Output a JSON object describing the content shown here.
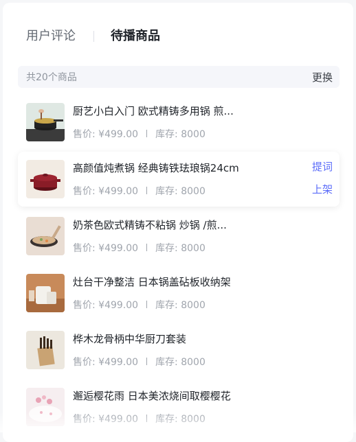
{
  "tabs": [
    {
      "label": "用户评论",
      "active": false
    },
    {
      "label": "待播商品",
      "active": true
    }
  ],
  "summary": {
    "count_text": "共20个商品",
    "refresh_label": "更换"
  },
  "products": [
    {
      "title": "厨艺小白入门 欧式精铸多用锅 煎...",
      "price": "售价: ¥499.00",
      "stock": "库存: 8000",
      "image": "pot-cooking-icon"
    },
    {
      "title": "高颜值炖煮锅 经典铸铁珐琅锅24cm",
      "price": "售价: ¥499.00",
      "stock": "库存: 8000",
      "image": "red-enamel-pot-icon",
      "actions": [
        "提词",
        "上架"
      ]
    },
    {
      "title": "奶茶色欧式精铸不粘锅 炒锅 /煎...",
      "price": "售价: ¥499.00",
      "stock": "库存: 8000",
      "image": "wok-icon"
    },
    {
      "title": "灶台干净整洁 日本锅盖砧板收纳架",
      "price": "售价: ¥499.00",
      "stock": "库存: 8000",
      "image": "lid-rack-icon"
    },
    {
      "title": "桦木龙骨柄中华厨刀套装",
      "price": "售价: ¥499.00",
      "stock": "库存: 8000",
      "image": "knife-block-icon"
    },
    {
      "title": "邂逅樱花雨 日本美浓烧间取樱樱花",
      "price": "售价: ¥499.00",
      "stock": "库存: 8000",
      "image": "sakura-plate-icon"
    }
  ]
}
